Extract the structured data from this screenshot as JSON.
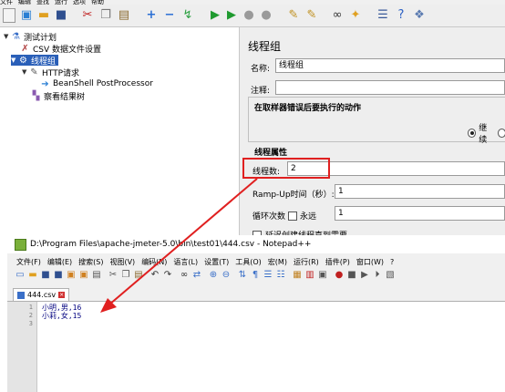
{
  "jmeter": {
    "menu": [
      "文件",
      "编辑",
      "查找",
      "运行",
      "选项",
      "帮助"
    ],
    "toolbar_icons": [
      "new-icon",
      "templates-icon",
      "open-icon",
      "save-icon",
      "cut-icon",
      "copy-icon",
      "paste-icon",
      "expand-icon",
      "collapse-icon",
      "toggle-icon",
      "start-icon",
      "start-no-pause-icon",
      "stop-icon",
      "shutdown-icon",
      "clear-icon",
      "clear-all-icon",
      "search-icon",
      "reset-search-icon",
      "function-helper-icon",
      "help-icon",
      "remote-icon"
    ],
    "tree": {
      "test_plan": "测试计划",
      "csv_config": "CSV 数据文件设置",
      "thread_group": "线程组",
      "http_request": "HTTP请求",
      "beanshell": "BeanShell PostProcessor",
      "results_tree": "察看结果树"
    },
    "panel": {
      "title": "线程组",
      "name_label": "名称:",
      "name_value": "线程组",
      "comment_label": "注释:",
      "error_action_title": "在取样器错误后要执行的动作",
      "continue_label": "继续",
      "thread_props_title": "线程属性",
      "threads_label": "线程数:",
      "threads_value": "2",
      "rampup_label": "Ramp-Up时间（秒）:",
      "rampup_value": "1",
      "loop_label": "循环次数",
      "forever_label": "永远",
      "loop_value": "1",
      "delay_label": "延迟创建线程直到需要"
    }
  },
  "notepad": {
    "title": "D:\\Program Files\\apache-jmeter-5.0\\bin\\test01\\444.csv - Notepad++",
    "menu": [
      "文件(F)",
      "编辑(E)",
      "搜索(S)",
      "视图(V)",
      "编码(N)",
      "语言(L)",
      "设置(T)",
      "工具(O)",
      "宏(M)",
      "运行(R)",
      "插件(P)",
      "窗口(W)",
      "?"
    ],
    "tab_label": "444.csv",
    "line_numbers": [
      "1",
      "2",
      "3"
    ],
    "lines": [
      "小明,男,16",
      "小莉,女,15",
      ""
    ]
  },
  "annotation": {
    "color": "#e02020"
  }
}
